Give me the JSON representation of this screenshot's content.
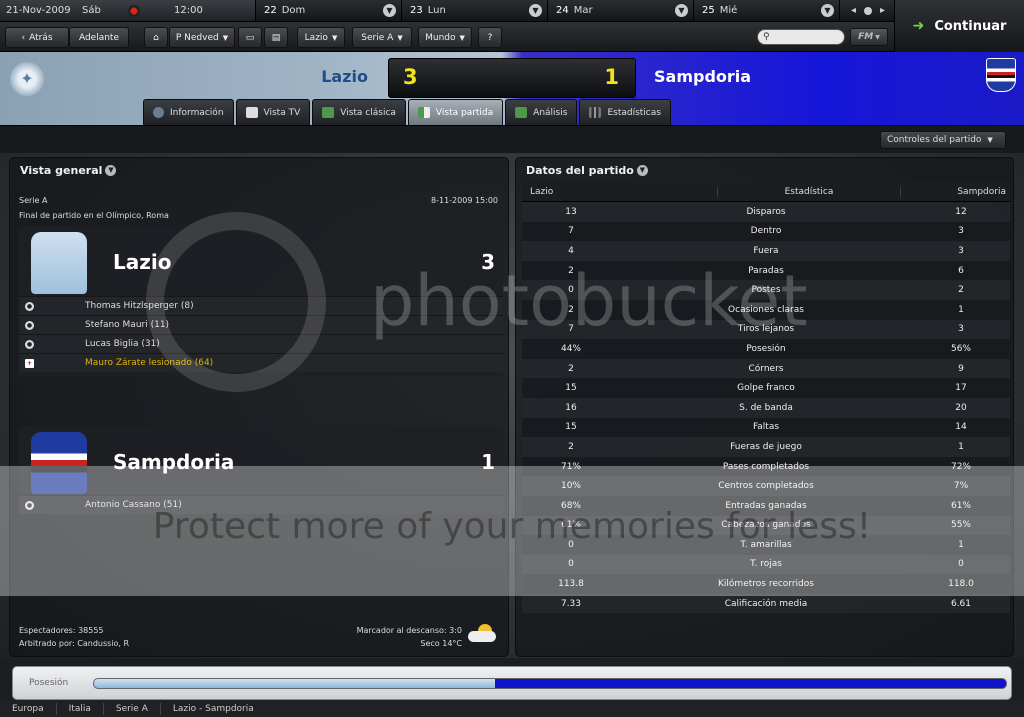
{
  "calendar": {
    "current_date": "21-Nov-2009",
    "current_day": "Sáb",
    "current_time": "12:00",
    "days": [
      {
        "num": "22",
        "name": "Dom"
      },
      {
        "num": "23",
        "name": "Lun"
      },
      {
        "num": "24",
        "name": "Mar"
      },
      {
        "num": "25",
        "name": "Mié"
      }
    ],
    "prev_icon": "chevron-left-icon",
    "next_icon": "chevron-right-icon"
  },
  "continue_label": "Continuar",
  "toolbar": {
    "back": "Atrás",
    "forward": "Adelante",
    "manager": "P Nedved",
    "club": "Lazio",
    "league": "Serie A",
    "world": "Mundo",
    "help": "?",
    "fm_label": "FM"
  },
  "match": {
    "home": "Lazio",
    "away": "Sampdoria",
    "home_score": "3",
    "away_score": "1",
    "home_color": "#9fb3c5",
    "away_color": "#1616d8",
    "score_color": "#f2e21b"
  },
  "tabs": [
    {
      "label": "Información",
      "icon": "info-icon"
    },
    {
      "label": "Vista TV",
      "icon": "tv-icon"
    },
    {
      "label": "Vista clásica",
      "icon": "pitch-icon"
    },
    {
      "label": "Vista partida",
      "icon": "split-view-icon"
    },
    {
      "label": "Análisis",
      "icon": "analysis-icon"
    },
    {
      "label": "Estadísticas",
      "icon": "bar-chart-icon"
    }
  ],
  "active_tab": "Vista partida",
  "match_controls": "Controles del partido",
  "overview": {
    "title": "Vista general",
    "competition": "Serie A",
    "date": "8-11-2009 15:00",
    "venue": "Final de partido en el Olímpico, Roma",
    "home": {
      "name": "Lazio",
      "score": "3",
      "events": [
        {
          "text": "Thomas Hitzlsperger (8)",
          "type": "goal"
        },
        {
          "text": "Stefano Mauri (11)",
          "type": "goal"
        },
        {
          "text": "Lucas Biglia (31)",
          "type": "goal"
        },
        {
          "text": "Mauro Zárate lesionado (64)",
          "type": "injury"
        }
      ]
    },
    "away": {
      "name": "Sampdoria",
      "score": "1",
      "events": [
        {
          "text": "Antonio Cassano (51)",
          "type": "goal"
        }
      ]
    },
    "attendance": "Espectadores: 38555",
    "referee": "Arbitrado por: Candussio, R",
    "halftime": "Marcador al descanso: 3:0",
    "weather": "Seco 14°C"
  },
  "stats": {
    "title": "Datos del partido",
    "headers": {
      "home": "Lazio",
      "stat": "Estadística",
      "away": "Sampdoria"
    },
    "rows": [
      {
        "home": "13",
        "stat": "Disparos",
        "away": "12"
      },
      {
        "home": "7",
        "stat": "Dentro",
        "away": "3"
      },
      {
        "home": "4",
        "stat": "Fuera",
        "away": "3"
      },
      {
        "home": "2",
        "stat": "Paradas",
        "away": "6"
      },
      {
        "home": "0",
        "stat": "Postes",
        "away": "2"
      },
      {
        "home": "2",
        "stat": "Ocasiones claras",
        "away": "1"
      },
      {
        "home": "7",
        "stat": "Tiros lejanos",
        "away": "3"
      },
      {
        "home": "44%",
        "stat": "Posesión",
        "away": "56%"
      },
      {
        "home": "2",
        "stat": "Córners",
        "away": "9"
      },
      {
        "home": "15",
        "stat": "Golpe franco",
        "away": "17"
      },
      {
        "home": "16",
        "stat": "S. de banda",
        "away": "20"
      },
      {
        "home": "15",
        "stat": "Faltas",
        "away": "14"
      },
      {
        "home": "2",
        "stat": "Fueras de juego",
        "away": "1"
      },
      {
        "home": "71%",
        "stat": "Pases completados",
        "away": "72%"
      },
      {
        "home": "10%",
        "stat": "Centros completados",
        "away": "7%"
      },
      {
        "home": "68%",
        "stat": "Entradas ganadas",
        "away": "61%"
      },
      {
        "home": "61%",
        "stat": "Cabezazos ganados",
        "away": "55%"
      },
      {
        "home": "0",
        "stat": "T. amarillas",
        "away": "1"
      },
      {
        "home": "0",
        "stat": "T. rojas",
        "away": "0"
      },
      {
        "home": "113.8",
        "stat": "Kilómetros recorridos",
        "away": "118.0"
      },
      {
        "home": "7.33",
        "stat": "Calificación media",
        "away": "6.61"
      }
    ]
  },
  "possession": {
    "label": "Posesión",
    "home_fraction": 0.44
  },
  "breadcrumb": [
    "Europa",
    "Italia",
    "Serie A",
    "Lazio - Sampdoria"
  ],
  "watermark": {
    "logo": "photobucket",
    "banner": "Protect more of your memories for less!"
  }
}
